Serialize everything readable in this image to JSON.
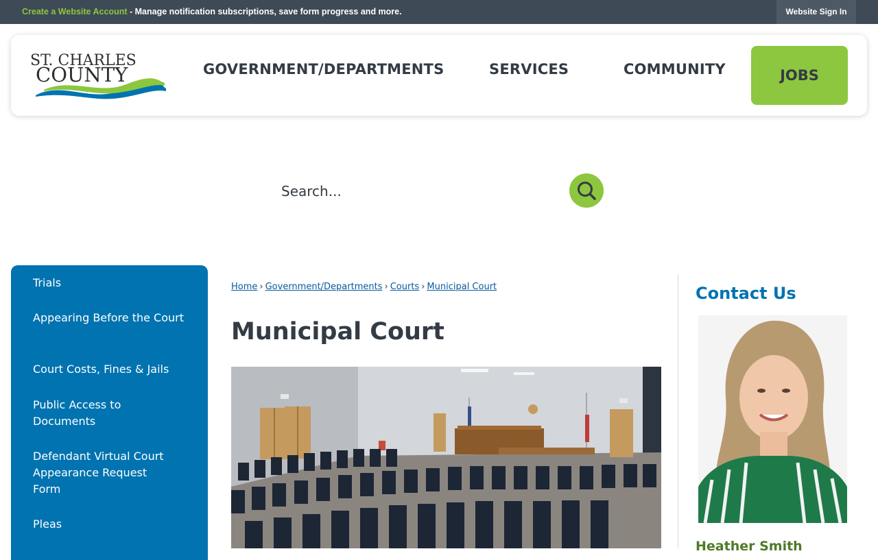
{
  "topbar": {
    "create_account_link": "Create a Website Account",
    "create_account_desc": " - Manage notification subscriptions, save form progress and more.",
    "sign_in": "Website Sign In"
  },
  "header": {
    "logo_line1": "ST. CHARLES",
    "logo_line2": "COUNTY",
    "nav": {
      "government": "GOVERNMENT/DEPARTMENTS",
      "services": "SERVICES",
      "community": "COMMUNITY",
      "jobs": "JOBS"
    }
  },
  "search": {
    "placeholder": "Search...",
    "icon": "search-icon"
  },
  "sidebar": {
    "items": [
      "Trials",
      "Appearing Before the Court",
      "Court Costs, Fines & Jails",
      "Public Access to Documents",
      "Defendant Virtual Court Appearance Request Form",
      "Pleas"
    ]
  },
  "breadcrumb": {
    "items": [
      "Home",
      "Government/Departments",
      "Courts",
      "Municipal Court"
    ],
    "separator": "›"
  },
  "main": {
    "title": "Municipal Court"
  },
  "contact": {
    "title": "Contact Us",
    "name": "Heather Smith"
  },
  "colors": {
    "accent_green": "#8dc63f",
    "sidebar_blue": "#0073b0",
    "topbar": "#3e4a56",
    "text_dark": "#333b44"
  }
}
